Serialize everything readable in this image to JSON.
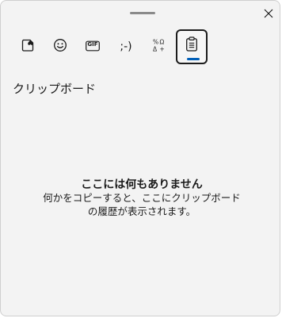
{
  "window": {
    "close_icon": "close-icon",
    "drag_handle": "drag-handle"
  },
  "tabs": [
    {
      "name": "tab-stickers",
      "icon": "heart-sticker-icon"
    },
    {
      "name": "tab-emoji",
      "icon": "smiley-icon"
    },
    {
      "name": "tab-gif",
      "icon": "gif-icon",
      "label": "GIF"
    },
    {
      "name": "tab-kaomoji",
      "icon": "kaomoji-icon",
      "label": ";-)"
    },
    {
      "name": "tab-symbols",
      "icon": "symbols-icon"
    },
    {
      "name": "tab-clipboard",
      "icon": "clipboard-icon",
      "active": true
    }
  ],
  "section": {
    "title": "クリップボード"
  },
  "empty_state": {
    "title": "ここには何もありません",
    "line1": "何かをコピーすると、ここにクリップボード",
    "line2": "の履歴が表示されます。"
  },
  "colors": {
    "background": "#f3f3f3",
    "accent": "#005fb8",
    "text": "#1a1a1a"
  }
}
